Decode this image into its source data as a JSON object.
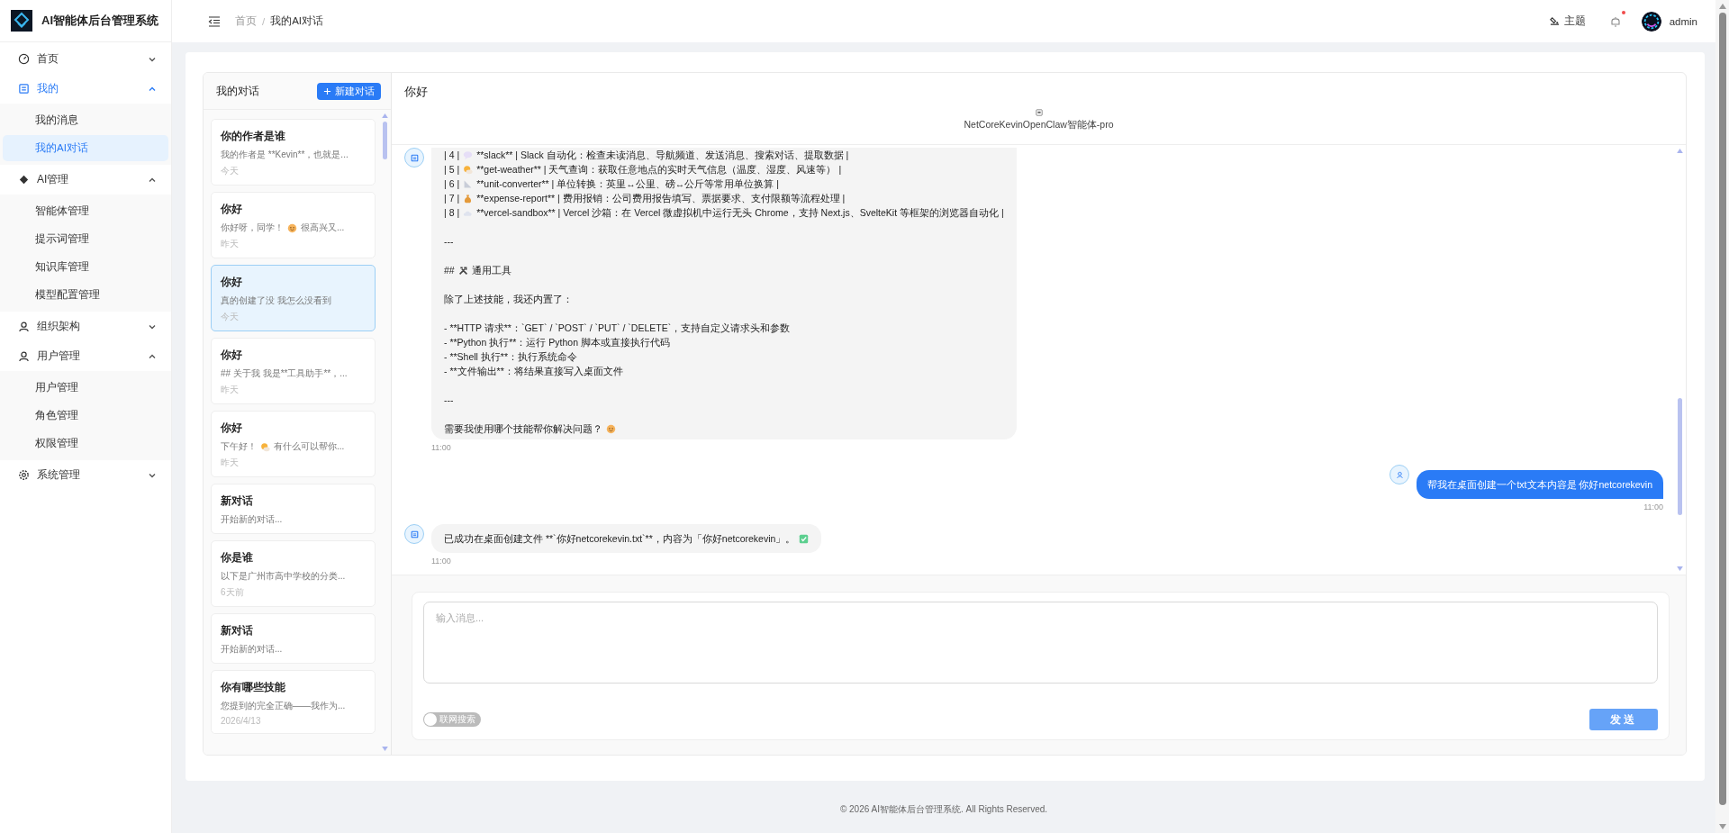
{
  "app": {
    "title": "AI智能体后台管理系统"
  },
  "sidebar": {
    "items": [
      {
        "kind": "gauge",
        "label": "首页",
        "expanded": false,
        "active": false
      },
      {
        "kind": "doc",
        "label": "我的",
        "expanded": true,
        "active": true,
        "children": [
          {
            "label": "我的消息",
            "selected": false
          },
          {
            "label": "我的AI对话",
            "selected": true
          }
        ]
      },
      {
        "kind": "diamond",
        "label": "AI管理",
        "expanded": true,
        "active": false,
        "children": [
          {
            "label": "智能体管理",
            "selected": false
          },
          {
            "label": "提示词管理",
            "selected": false
          },
          {
            "label": "知识库管理",
            "selected": false
          },
          {
            "label": "模型配置管理",
            "selected": false
          }
        ]
      },
      {
        "kind": "user",
        "label": "组织架构",
        "expanded": false,
        "active": false
      },
      {
        "kind": "user",
        "label": "用户管理",
        "expanded": true,
        "active": false,
        "children": [
          {
            "label": "用户管理",
            "selected": false
          },
          {
            "label": "角色管理",
            "selected": false
          },
          {
            "label": "权限管理",
            "selected": false
          }
        ]
      },
      {
        "kind": "gear",
        "label": "系统管理",
        "expanded": false,
        "active": false
      }
    ]
  },
  "header": {
    "breadcrumb": [
      "首页",
      "我的AI对话"
    ],
    "separator": "/",
    "theme_label": "主题",
    "has_unread": true,
    "username": "admin"
  },
  "conversations": {
    "title": "我的对话",
    "new_button": "新建对话",
    "items": [
      {
        "title": "你的作者是谁",
        "preview": [
          {
            "text": "我的作者是 **Kevin**，也就是..."
          }
        ],
        "time": "今天",
        "selected": false
      },
      {
        "title": "你好",
        "preview": [
          {
            "text": "你好呀，同学！"
          },
          {
            "kind": "smile"
          },
          {
            "text": "很高兴又..."
          }
        ],
        "time": "昨天",
        "selected": false
      },
      {
        "title": "你好",
        "preview": [
          {
            "text": "真的创建了没 我怎么没看到"
          }
        ],
        "time": "今天",
        "selected": true
      },
      {
        "title": "你好",
        "preview": [
          {
            "text": "## 关于我 我是**工具助手**，..."
          }
        ],
        "time": "昨天",
        "selected": false
      },
      {
        "title": "你好",
        "preview": [
          {
            "text": "下午好！"
          },
          {
            "kind": "sun"
          },
          {
            "text": "有什么可以帮你..."
          }
        ],
        "time": "昨天",
        "selected": false
      },
      {
        "title": "新对话",
        "preview": [
          {
            "text": "开始新的对话..."
          }
        ],
        "selected": false
      },
      {
        "title": "你是谁",
        "preview": [
          {
            "text": "以下是广州市高中学校的分类..."
          }
        ],
        "time": "6天前",
        "selected": false
      },
      {
        "title": "新对话",
        "preview": [
          {
            "text": "开始新的对话..."
          }
        ],
        "selected": false
      },
      {
        "title": "你有哪些技能",
        "preview": [
          {
            "text": "您提到的完全正确——我作为..."
          }
        ],
        "time": "2026/4/13",
        "selected": false
      }
    ]
  },
  "chat": {
    "title": "你好",
    "agent_name": "NetCoreKevinOpenClaw智能体-pro",
    "messages": [
      {
        "kind": "assistant",
        "blocks": [
          [
            [
              {
                "text": "| 4 |"
              },
              {
                "kind": "speech"
              },
              {
                "text": "**slack** | Slack 自动化：检查未读消息、导航频道、发送消息、搜索对话、提取数据 |"
              }
            ],
            [
              {
                "text": "| 5 |"
              },
              {
                "kind": "sun"
              },
              {
                "text": "**get-weather** | 天气查询：获取任意地点的实时天气信息（温度、湿度、风速等） |"
              }
            ],
            [
              {
                "text": "| 6 |"
              },
              {
                "kind": "ruler"
              },
              {
                "text": "**unit-converter** | 单位转换：英里↔公里、磅↔公斤等常用单位换算 |"
              }
            ],
            [
              {
                "text": "| 7 |"
              },
              {
                "kind": "bag"
              },
              {
                "text": "**expense-report** | 费用报销：公司费用报告填写、票据要求、支付限额等流程处理 |"
              }
            ],
            [
              {
                "text": "| 8 |"
              },
              {
                "kind": "cloud"
              },
              {
                "text": "**vercel-sandbox** | Vercel 沙箱：在 Vercel 微虚拟机中运行无头 Chrome，支持 Next.js、SvelteKit 等框架的浏览器自动化 |"
              }
            ]
          ],
          [
            [
              {
                "text": "---"
              }
            ]
          ],
          [
            [
              {
                "text": "##"
              },
              {
                "kind": "tools"
              },
              {
                "text": "通用工具"
              }
            ]
          ],
          [
            [
              {
                "text": "除了上述技能，我还内置了："
              }
            ]
          ],
          [
            [
              {
                "text": "- **HTTP 请求**：`GET` / `POST` / `PUT` / `DELETE`，支持自定义请求头和参数"
              }
            ],
            [
              {
                "text": "- **Python 执行**：运行 Python 脚本或直接执行代码"
              }
            ],
            [
              {
                "text": "- **Shell 执行**：执行系统命令"
              }
            ],
            [
              {
                "text": "- **文件输出**：将结果直接写入桌面文件"
              }
            ]
          ],
          [
            [
              {
                "text": "---"
              }
            ]
          ],
          [
            [
              {
                "text": "需要我使用哪个技能帮你解决问题？"
              },
              {
                "kind": "smile"
              }
            ]
          ]
        ],
        "time": "11:00"
      },
      {
        "kind": "user",
        "blocks": [
          [
            [
              {
                "text": "帮我在桌面创建一个txt文本内容是 你好netcorekevin"
              }
            ]
          ]
        ],
        "time": "11:00"
      },
      {
        "kind": "assistant",
        "blocks": [
          [
            [
              {
                "text": "已成功在桌面创建文件 **`你好netcorekevin.txt`**，内容为「你好netcorekevin」。"
              },
              {
                "kind": "check"
              }
            ]
          ]
        ],
        "time": "11:00"
      }
    ],
    "input": {
      "placeholder": "输入消息..."
    },
    "web_search": {
      "label": "联网搜索",
      "on": false
    },
    "send_button": {
      "label": "发送",
      "disabled": true
    }
  },
  "footer": {
    "text": "© 2026 AI智能体后台管理系统. All Rights Reserved."
  }
}
